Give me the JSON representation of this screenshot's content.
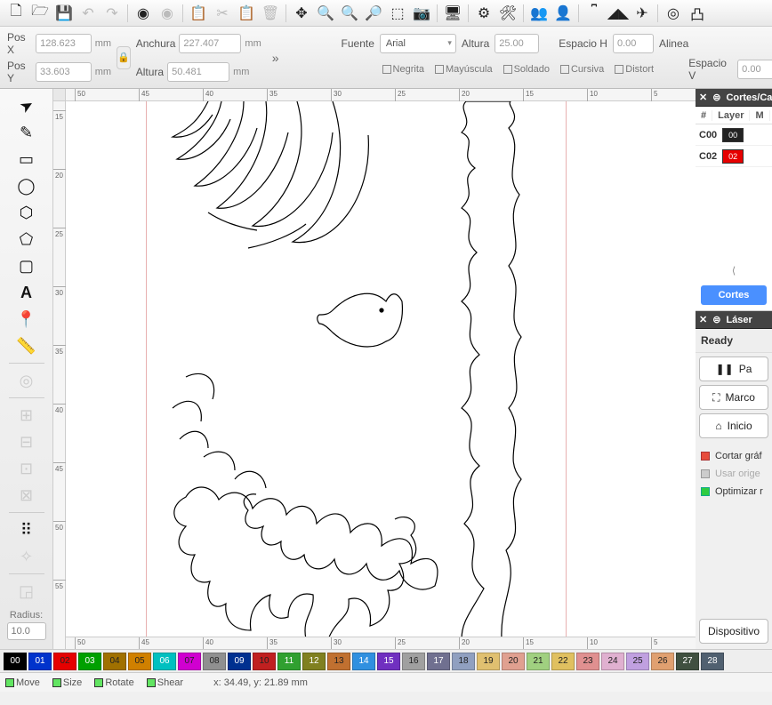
{
  "topIcons": [
    {
      "name": "new-file-icon",
      "glyph": "🗋",
      "dim": false
    },
    {
      "name": "open-folder-icon",
      "glyph": "🗁",
      "dim": false
    },
    {
      "name": "save-icon",
      "glyph": "💾",
      "dim": false
    },
    {
      "name": "undo-icon",
      "glyph": "↶",
      "dim": true
    },
    {
      "name": "redo-icon",
      "glyph": "↷",
      "dim": true
    },
    {
      "name": "sep",
      "glyph": "",
      "dim": false,
      "sep": true
    },
    {
      "name": "undo2-icon",
      "glyph": "◉",
      "dim": false
    },
    {
      "name": "redo2-icon",
      "glyph": "◉",
      "dim": true
    },
    {
      "name": "sep",
      "glyph": "",
      "dim": false,
      "sep": true
    },
    {
      "name": "copy-icon",
      "glyph": "📋",
      "dim": true
    },
    {
      "name": "cut-icon",
      "glyph": "✂",
      "dim": true
    },
    {
      "name": "paste-icon",
      "glyph": "📋",
      "dim": true
    },
    {
      "name": "delete-icon",
      "glyph": "🗑",
      "dim": true
    },
    {
      "name": "sep",
      "glyph": "",
      "dim": false,
      "sep": true
    },
    {
      "name": "move-icon",
      "glyph": "✥",
      "dim": false
    },
    {
      "name": "zoom-fit-icon",
      "glyph": "🔍",
      "dim": false
    },
    {
      "name": "zoom-in-icon",
      "glyph": "🔍",
      "dim": false
    },
    {
      "name": "zoom-out-icon",
      "glyph": "🔎",
      "dim": false
    },
    {
      "name": "select-rect-icon",
      "glyph": "⬚",
      "dim": false
    },
    {
      "name": "camera-icon",
      "glyph": "📷",
      "dim": false
    },
    {
      "name": "sep",
      "glyph": "",
      "dim": false,
      "sep": true
    },
    {
      "name": "monitor-icon",
      "glyph": "🖥",
      "dim": false
    },
    {
      "name": "sep",
      "glyph": "",
      "dim": false,
      "sep": true
    },
    {
      "name": "gear-icon",
      "glyph": "⚙",
      "dim": false
    },
    {
      "name": "wrench-icon",
      "glyph": "🛠",
      "dim": false
    },
    {
      "name": "sep",
      "glyph": "",
      "dim": false,
      "sep": true
    },
    {
      "name": "group-icon",
      "glyph": "👥",
      "dim": true
    },
    {
      "name": "ungroup-icon",
      "glyph": "👤",
      "dim": true
    },
    {
      "name": "sep",
      "glyph": "",
      "dim": false,
      "sep": true
    },
    {
      "name": "align-top-icon",
      "glyph": "⎴",
      "dim": false
    },
    {
      "name": "flip-h-icon",
      "glyph": "◢◣",
      "dim": false
    },
    {
      "name": "send-icon",
      "glyph": "✈",
      "dim": false
    },
    {
      "name": "sep",
      "glyph": "",
      "dim": false,
      "sep": true
    },
    {
      "name": "target-icon",
      "glyph": "◎",
      "dim": false
    },
    {
      "name": "align-top2-icon",
      "glyph": "凸",
      "dim": false
    }
  ],
  "props": {
    "posX": {
      "label": "Pos X",
      "value": "128.623",
      "unit": "mm"
    },
    "posY": {
      "label": "Pos Y",
      "value": "33.603",
      "unit": "mm"
    },
    "width": {
      "label": "Anchura",
      "value": "227.407",
      "unit": "mm"
    },
    "height": {
      "label": "Altura",
      "value": "50.481",
      "unit": "mm"
    }
  },
  "font": {
    "label": "Fuente",
    "value": "Arial",
    "heightLabel": "Altura",
    "heightValue": "25.00",
    "espacioH": {
      "label": "Espacio H",
      "value": "0.00"
    },
    "espacioV": {
      "label": "Espacio V",
      "value": "0.00"
    },
    "alinea": "Alinea",
    "checks": [
      {
        "label": "Negrita"
      },
      {
        "label": "Mayúscula"
      },
      {
        "label": "Soldado"
      },
      {
        "label": "Cursiva"
      },
      {
        "label": "Distort"
      }
    ]
  },
  "tools": [
    {
      "name": "pointer-tool",
      "glyph": "➤",
      "rot": true
    },
    {
      "name": "pencil-tool",
      "glyph": "✎"
    },
    {
      "name": "rect-tool",
      "glyph": "▭"
    },
    {
      "name": "ellipse-tool",
      "glyph": "◯"
    },
    {
      "name": "polygon-tool",
      "glyph": "⬡"
    },
    {
      "name": "path-tool",
      "glyph": "⬠"
    },
    {
      "name": "round-rect-tool",
      "glyph": "▢"
    },
    {
      "name": "text-tool",
      "glyph": "A",
      "bold": true
    },
    {
      "name": "pin-tool",
      "glyph": "📍"
    },
    {
      "name": "ruler-tool",
      "glyph": "📏"
    },
    {
      "name": "hr",
      "sep": true
    },
    {
      "name": "offset-tool",
      "glyph": "◎",
      "dim": true
    },
    {
      "name": "hr",
      "sep": true
    },
    {
      "name": "bool1-tool",
      "glyph": "⊞",
      "dim": true
    },
    {
      "name": "bool2-tool",
      "glyph": "⊟",
      "dim": true
    },
    {
      "name": "bool3-tool",
      "glyph": "⊡",
      "dim": true
    },
    {
      "name": "bool4-tool",
      "glyph": "⊠",
      "dim": true
    },
    {
      "name": "hr",
      "sep": true
    },
    {
      "name": "grid-tool",
      "glyph": "⠿"
    },
    {
      "name": "array-tool",
      "glyph": "✧",
      "dim": true
    },
    {
      "name": "hr",
      "sep": true
    },
    {
      "name": "corner-tool",
      "glyph": "◲",
      "dim": true
    }
  ],
  "radius": {
    "label": "Radius:",
    "value": "10.0"
  },
  "ruler": {
    "hTicks": [
      "50",
      "45",
      "40",
      "35",
      "30",
      "25",
      "20",
      "15",
      "10",
      "5"
    ],
    "hBottomTicks": [
      "50",
      "45",
      "40",
      "35",
      "30",
      "25",
      "20",
      "15",
      "10",
      "5"
    ],
    "vTicks": [
      "15",
      "20",
      "25",
      "30",
      "35",
      "40",
      "45",
      "50",
      "55"
    ]
  },
  "panels": {
    "cuts": {
      "title": "Cortes/Ca",
      "headers": [
        "#",
        "Layer",
        "M"
      ],
      "layers": [
        {
          "name": "C00",
          "swatch": "#222222",
          "id": "00"
        },
        {
          "name": "C02",
          "swatch": "#e60000",
          "id": "02"
        }
      ],
      "btn": "Cortes"
    },
    "laser": {
      "title": "Láser",
      "ready": "Ready",
      "pauseBtn": "Pa",
      "marcoBtn": "Marco",
      "inicioBtn": "Inicio",
      "opts": [
        {
          "class": "sq-red",
          "label": "Cortar gráf"
        },
        {
          "class": "sq-grey",
          "label": "Usar orige",
          "dim": true
        },
        {
          "class": "sq-green",
          "label": "Optimizar r"
        }
      ],
      "dispositivo": "Dispositivo"
    }
  },
  "colors": [
    {
      "id": "00",
      "hex": "#000000"
    },
    {
      "id": "01",
      "hex": "#0033cc"
    },
    {
      "id": "02",
      "hex": "#e60000"
    },
    {
      "id": "03",
      "hex": "#00a000"
    },
    {
      "id": "04",
      "hex": "#a07000"
    },
    {
      "id": "05",
      "hex": "#d08000"
    },
    {
      "id": "06",
      "hex": "#00c0c0"
    },
    {
      "id": "07",
      "hex": "#d000d0"
    },
    {
      "id": "08",
      "hex": "#909090"
    },
    {
      "id": "09",
      "hex": "#003090"
    },
    {
      "id": "10",
      "hex": "#c02020"
    },
    {
      "id": "11",
      "hex": "#30a030"
    },
    {
      "id": "12",
      "hex": "#808020"
    },
    {
      "id": "13",
      "hex": "#c07030"
    },
    {
      "id": "14",
      "hex": "#3090e0"
    },
    {
      "id": "15",
      "hex": "#7030c0"
    },
    {
      "id": "16",
      "hex": "#a0a0a0"
    },
    {
      "id": "17",
      "hex": "#707090"
    },
    {
      "id": "18",
      "hex": "#90a0c0"
    },
    {
      "id": "19",
      "hex": "#e0c070"
    },
    {
      "id": "20",
      "hex": "#e0a090"
    },
    {
      "id": "21",
      "hex": "#a0d080"
    },
    {
      "id": "22",
      "hex": "#e0c060"
    },
    {
      "id": "23",
      "hex": "#e09090"
    },
    {
      "id": "24",
      "hex": "#e0b0d0"
    },
    {
      "id": "25",
      "hex": "#c0a0e0"
    },
    {
      "id": "26",
      "hex": "#e0a070"
    },
    {
      "id": "27",
      "hex": "#405040"
    },
    {
      "id": "28",
      "hex": "#506070"
    }
  ],
  "status": {
    "move": "Move",
    "size": "Size",
    "rotate": "Rotate",
    "shear": "Shear",
    "coords": "x: 34.49, y: 21.89 mm"
  }
}
